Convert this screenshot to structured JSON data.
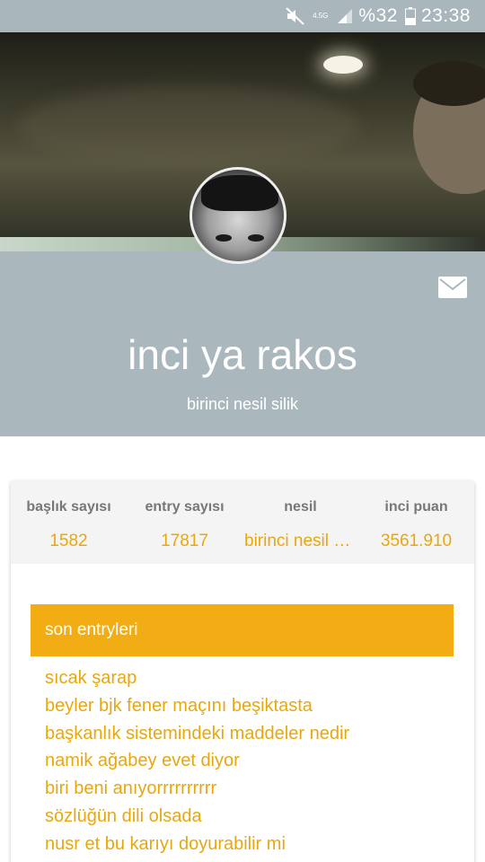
{
  "status_bar": {
    "network": "4.5G",
    "battery": "%32",
    "time": "23:38",
    "icons": [
      "mute-icon",
      "network-icon",
      "signal-icon",
      "battery-icon"
    ]
  },
  "profile": {
    "name": "inci ya rakos",
    "subtitle": "birinci nesil silik",
    "mail_icon": "mail-icon"
  },
  "stats": [
    {
      "label": "başlık sayısı",
      "value": "1582"
    },
    {
      "label": "entry sayısı",
      "value": "17817"
    },
    {
      "label": "nesil",
      "value": "birinci nesil silik"
    },
    {
      "label": "inci puan",
      "value": "3561.910"
    }
  ],
  "entries": {
    "header": "son entryleri",
    "items": [
      "sıcak şarap",
      "beyler bjk fener maçını beşiktasta",
      "başkanlık sistemindeki maddeler nedir",
      "namik ağabey evet diyor",
      "biri beni anıyorrrrrrrrrr",
      "sözlüğün dili olsada",
      "nusr et bu karıyı doyurabilir mi"
    ]
  },
  "colors": {
    "accent": "#f2ad14",
    "accent_text": "#e9a70e",
    "profile_band": "#aab8bd",
    "status_bar": "#a9b7bd"
  }
}
